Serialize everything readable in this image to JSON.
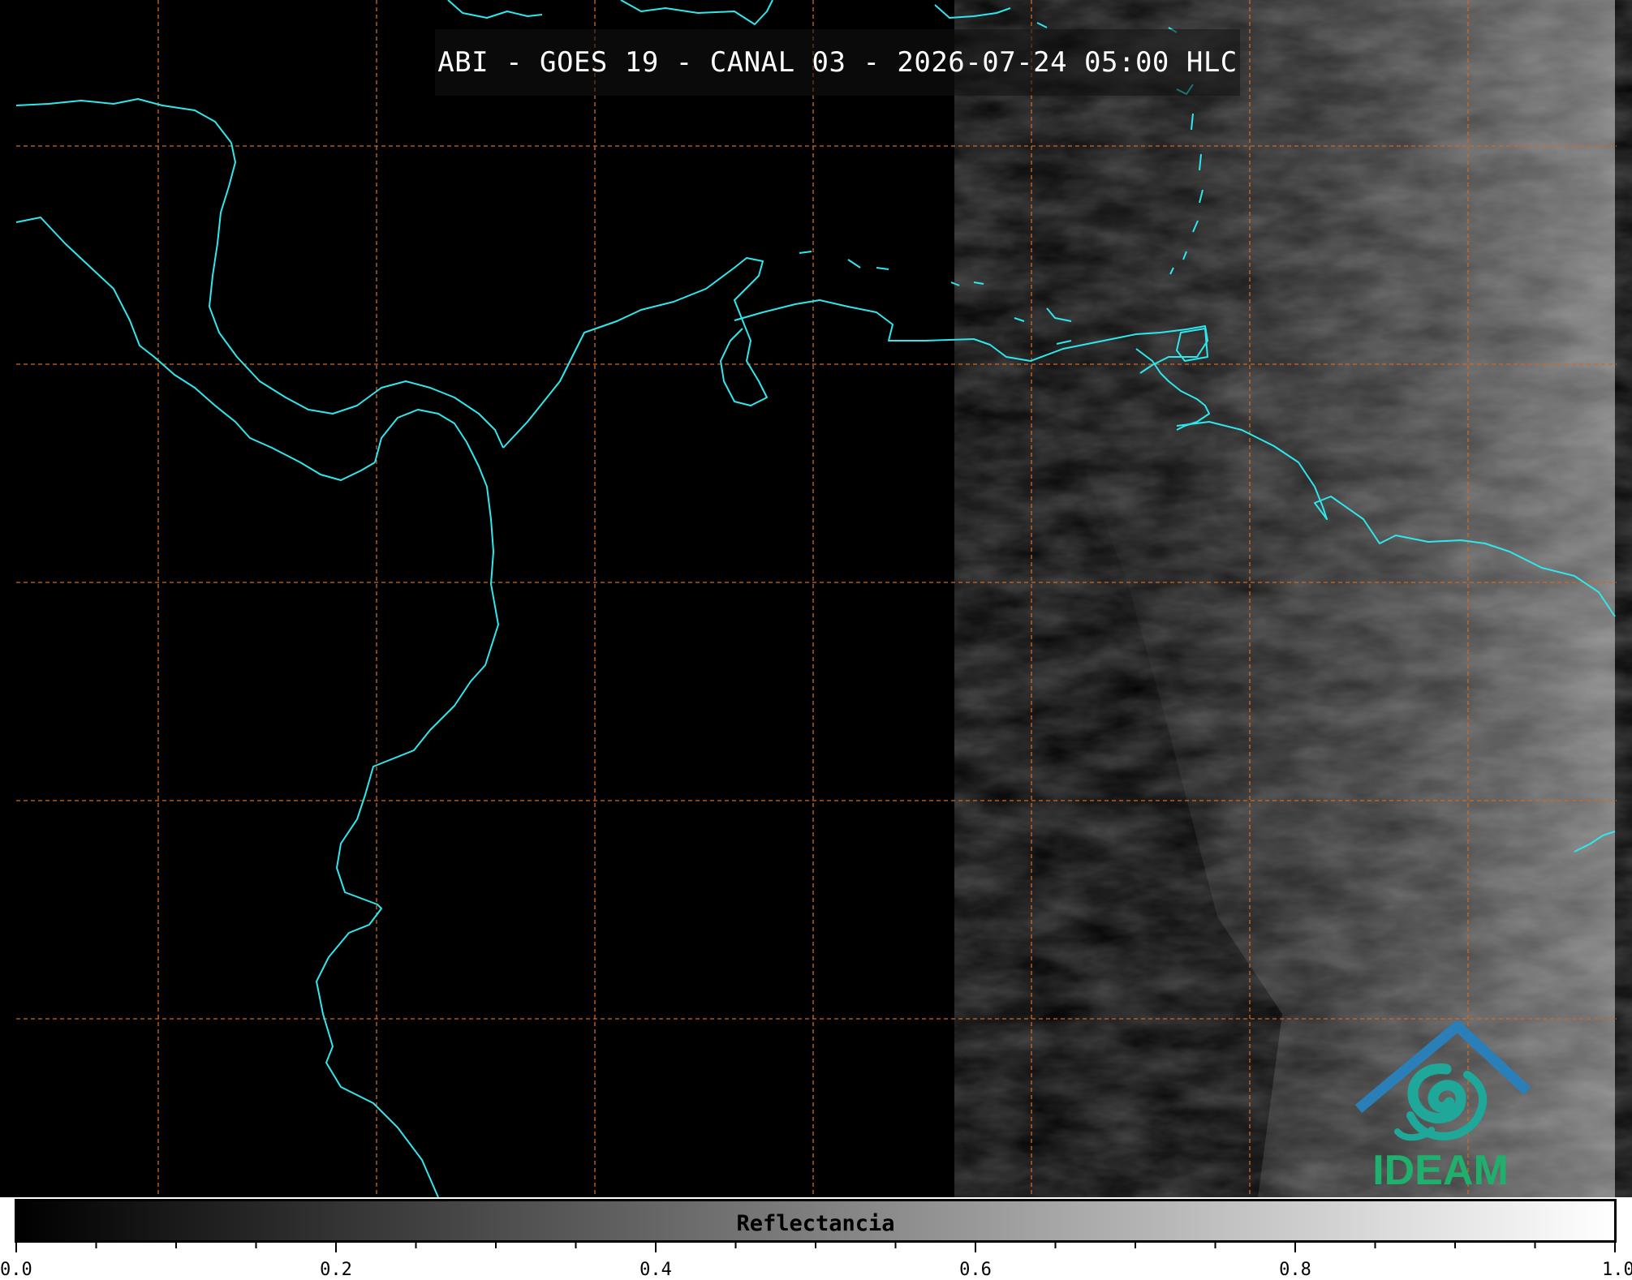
{
  "title": "ABI - GOES 19 - CANAL 03 - 2026-07-24 05:00 HLC",
  "colorbar": {
    "label": "Reflectancia",
    "min": 0.0,
    "max": 1.0,
    "tick_labels": [
      "0.0",
      "0.2",
      "0.4",
      "0.6",
      "0.8",
      "1.0"
    ],
    "gradient_from": "#000000",
    "gradient_to": "#ffffff"
  },
  "logo": {
    "text": "IDEAM",
    "roof_color": "#2a7fb8",
    "swirl_color": "#1fa89a",
    "text_color": "#1fb06e"
  },
  "colors": {
    "background": "#000000",
    "coastline": "#2ee8ee",
    "gridline": "#d2691e",
    "clouds": "#6e6e6e"
  },
  "icons": [
    "ideam-logo-icon"
  ]
}
